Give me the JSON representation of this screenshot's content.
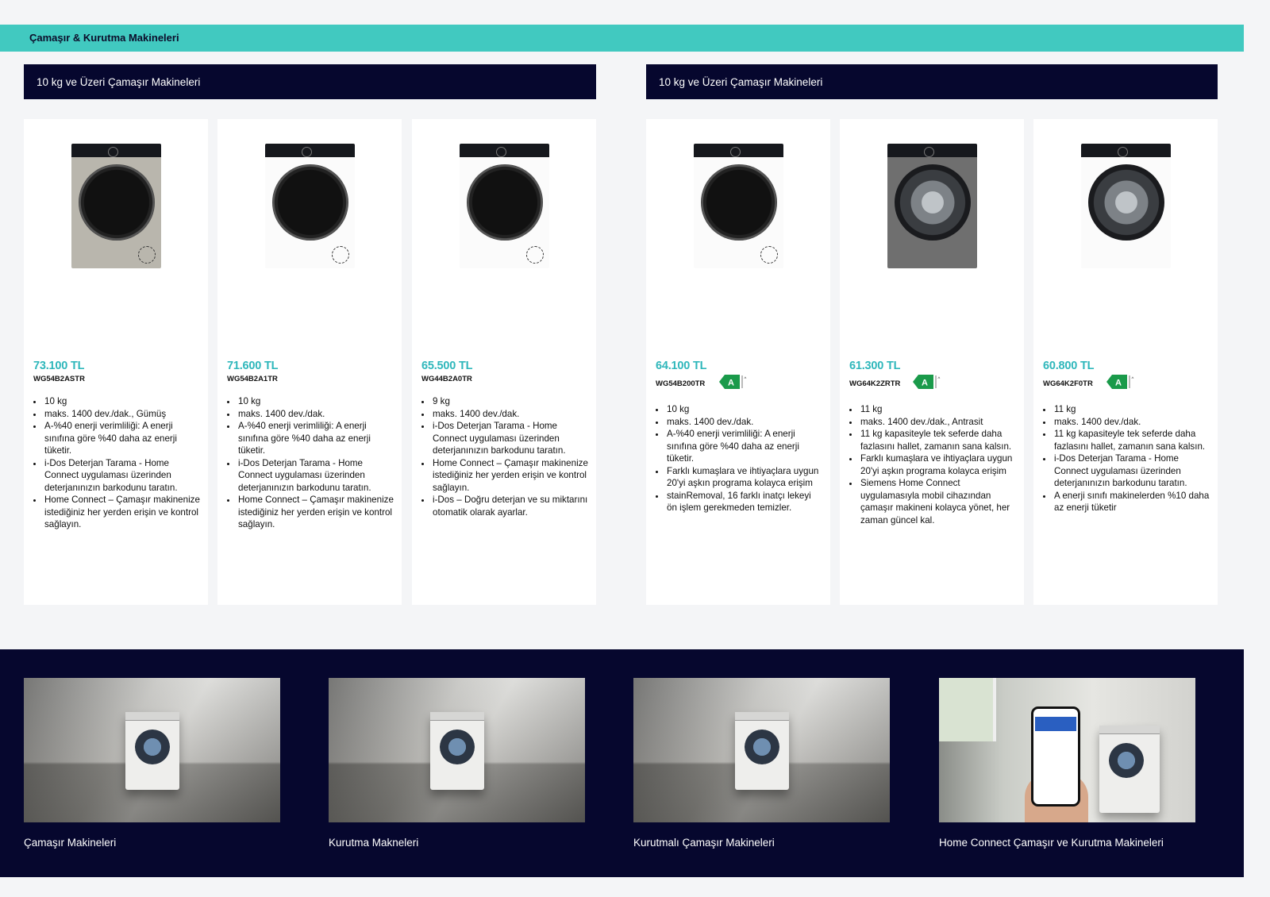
{
  "page_title": "Çamaşır & Kurutma Makineleri",
  "sections": [
    {
      "title": "10 kg ve Üzeri Çamaşır Makineleri"
    },
    {
      "title": "10 kg ve Üzeri Çamaşır Makineleri"
    }
  ],
  "products": [
    {
      "price": "73.100 TL",
      "model": "WG54B2ASTR",
      "energy_class": "",
      "color": "#b9b6ad",
      "door": "dark",
      "features": [
        "10 kg",
        "maks. 1400 dev./dak., Gümüş",
        "A-%40 enerji verimliliği: A enerji sınıfına göre %40 daha az enerji tüketir.",
        "i-Dos Deterjan Tarama - Home Connect uygulaması üzerinden deterjanınızın barkodunu taratın.",
        "Home Connect – Çamaşır makinenize istediğiniz her yerden erişin ve kontrol sağlayın."
      ]
    },
    {
      "price": "71.600 TL",
      "model": "WG54B2A1TR",
      "energy_class": "",
      "color": "#fbfbfb",
      "door": "dark",
      "features": [
        "10 kg",
        "maks. 1400 dev./dak.",
        "A-%40 enerji verimliliği: A enerji sınıfına göre %40 daha az enerji tüketir.",
        "i-Dos Deterjan Tarama - Home Connect uygulaması üzerinden deterjanınızın barkodunu taratın.",
        "Home Connect – Çamaşır makinenize istediğiniz her yerden erişin ve kontrol sağlayın."
      ]
    },
    {
      "price": "65.500 TL",
      "model": "WG44B2A0TR",
      "energy_class": "",
      "color": "#fbfbfb",
      "door": "dark",
      "features": [
        "9 kg",
        "maks. 1400 dev./dak.",
        "i-Dos Deterjan Tarama - Home Connect uygulaması üzerinden deterjanınızın barkodunu taratın.",
        "Home Connect – Çamaşır makinenize istediğiniz her yerden erişin ve kontrol sağlayın.",
        "i-Dos – Doğru deterjan ve su miktarını otomatik olarak ayarlar."
      ]
    },
    {
      "price": "64.100 TL",
      "model": "WG54B200TR",
      "energy_class": "A",
      "color": "#fbfbfb",
      "door": "dark",
      "features": [
        "10 kg",
        "maks. 1400 dev./dak.",
        "A-%40 enerji verimliliği: A enerji sınıfına göre %40 daha az enerji tüketir.",
        "Farklı kumaşlara ve ihtiyaçlara uygun 20'yi aşkın programa kolayca erişim",
        "stainRemoval, 16 farklı inatçı lekeyi ön işlem gerekmeden temizler."
      ]
    },
    {
      "price": "61.300 TL",
      "model": "WG64K2ZRTR",
      "energy_class": "A",
      "color": "#6f6f6f",
      "door": "glass",
      "features": [
        "11 kg",
        "maks. 1400 dev./dak., Antrasit",
        "11 kg kapasiteyle tek seferde daha fazlasını hallet, zamanın sana kalsın.",
        "Farklı kumaşlara ve ihtiyaçlara uygun 20'yi aşkın programa kolayca erişim",
        "Siemens Home Connect uygulamasıyla mobil cihazından çamaşır makineni kolayca yönet, her zaman güncel kal."
      ]
    },
    {
      "price": "60.800 TL",
      "model": "WG64K2F0TR",
      "energy_class": "A",
      "color": "#fbfbfb",
      "door": "glass",
      "features": [
        "11 kg",
        "maks. 1400 dev./dak.",
        "11 kg kapasiteyle tek seferde daha fazlasını hallet, zamanın sana kalsın.",
        "i-Dos Deterjan Tarama - Home Connect uygulaması üzerinden deterjanınızın barkodunu taratın.",
        "A enerji sınıfı makinelerden %10 daha az enerji tüketir"
      ]
    }
  ],
  "categories": [
    {
      "label": "Çamaşır Makineleri"
    },
    {
      "label": "Kurutma Makneleri"
    },
    {
      "label": "Kurutmalı Çamaşır Makineleri"
    },
    {
      "label": "Home Connect Çamaşır ve Kurutma Makineleri"
    }
  ],
  "colors": {
    "accent": "#41c9c0",
    "navy": "#06072e",
    "price": "#2fb7bb",
    "energy_green": "#1a9a4a"
  }
}
